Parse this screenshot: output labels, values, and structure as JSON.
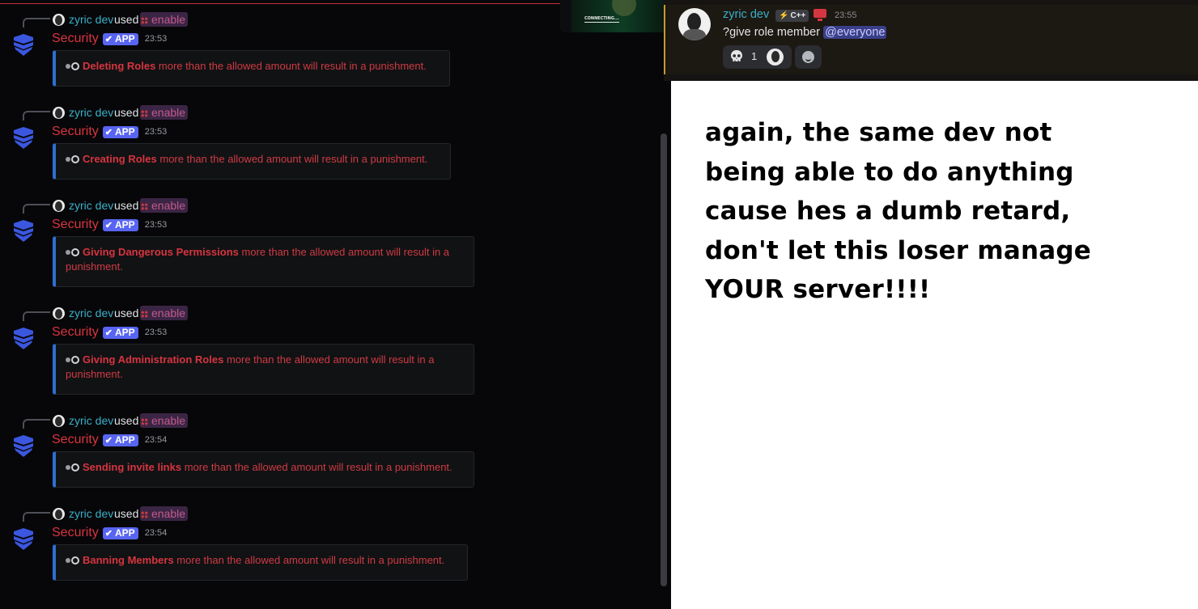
{
  "log": {
    "entries": [
      {
        "user": "zyric dev",
        "used": "used",
        "command": "enable",
        "bot": "Security",
        "badge": "APP",
        "time": "23:53",
        "action": "Deleting Roles",
        "rest": " more than the allowed amount will result in a punishment."
      },
      {
        "user": "zyric dev",
        "used": "used",
        "command": "enable",
        "bot": "Security",
        "badge": "APP",
        "time": "23:53",
        "action": "Creating Roles",
        "rest": " more than the allowed amount will result in a punishment."
      },
      {
        "user": "zyric dev",
        "used": "used",
        "command": "enable",
        "bot": "Security",
        "badge": "APP",
        "time": "23:53",
        "action": "Giving Dangerous Permissions",
        "rest": " more than the allowed amount will result in a punishment."
      },
      {
        "user": "zyric dev",
        "used": "used",
        "command": "enable",
        "bot": "Security",
        "badge": "APP",
        "time": "23:53",
        "action": "Giving Administration Roles",
        "rest": " more than the allowed amount will result in a punishment."
      },
      {
        "user": "zyric dev",
        "used": "used",
        "command": "enable",
        "bot": "Security",
        "badge": "APP",
        "time": "23:54",
        "action": "Sending invite links",
        "rest": " more than the allowed amount will result in a punishment."
      },
      {
        "user": "zyric dev",
        "used": "used",
        "command": "enable",
        "bot": "Security",
        "badge": "APP",
        "time": "23:54",
        "action": "Banning Members",
        "rest": " more than the allowed amount will result in a punishment."
      }
    ]
  },
  "stream_thumb": {
    "label": "CONNECTING..."
  },
  "chat": {
    "author": "zyric dev",
    "tag": "C++",
    "time": "23:55",
    "text": "?give role member ",
    "mention": "@everyone",
    "reaction_count": "1"
  },
  "caption": {
    "lines": [
      "again, the same dev not",
      "being able to do anything",
      "cause hes a dumb retard,",
      "don't let this loser manage",
      "YOUR server!!!!"
    ]
  },
  "colors": {
    "accent": "#5865f2",
    "danger": "#d9343f",
    "user": "#3ab0c9"
  }
}
